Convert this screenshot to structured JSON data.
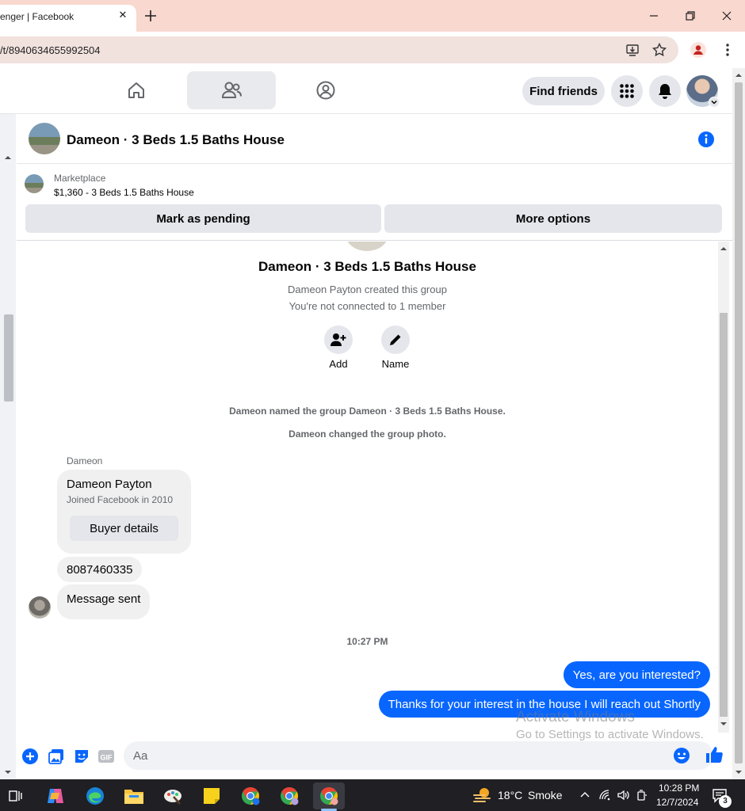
{
  "browser": {
    "tab_title": "enger | Facebook",
    "tab_close": "✕",
    "url": "/t/8940634655992504"
  },
  "fb_nav": {
    "find_friends_label": "Find friends"
  },
  "conversation": {
    "title": "Dameon · 3 Beds 1.5 Baths House"
  },
  "marketplace": {
    "label": "Marketplace",
    "listing": "$1,360 - 3 Beds 1.5 Baths House",
    "mark_pending_label": "Mark as pending",
    "more_options_label": "More options"
  },
  "group_intro": {
    "name": "Dameon · 3 Beds 1.5 Baths House",
    "created_by": "Dameon Payton created this group",
    "connection_note": "You're not connected to 1 member",
    "add_label": "Add",
    "name_label": "Name"
  },
  "events": {
    "renamed": "Dameon named the group Dameon · 3 Beds 1.5 Baths House.",
    "photo_changed": "Dameon changed the group photo."
  },
  "messages": {
    "sender_label": "Dameon",
    "profile_card": {
      "name": "Dameon Payton",
      "joined": "Joined Facebook in 2010",
      "button": "Buyer details"
    },
    "incoming": [
      "8087460335",
      "Message sent"
    ],
    "timestamp": "10:27 PM",
    "outgoing": [
      "Yes, are you interested?",
      "Thanks for your interest in the house I will reach out Shortly"
    ]
  },
  "watermark": {
    "line1": "Activate Windows",
    "line2": "Go to Settings to activate Windows."
  },
  "composer": {
    "placeholder": "Aa",
    "gif_label": "GIF"
  },
  "taskbar": {
    "weather_temp": "18°C",
    "weather_desc": "Smoke",
    "time": "10:28 PM",
    "date": "12/7/2024",
    "notifications_count": "3"
  },
  "colors": {
    "messenger_blue": "#0866ff",
    "tab_strip": "#f9d8cf"
  }
}
